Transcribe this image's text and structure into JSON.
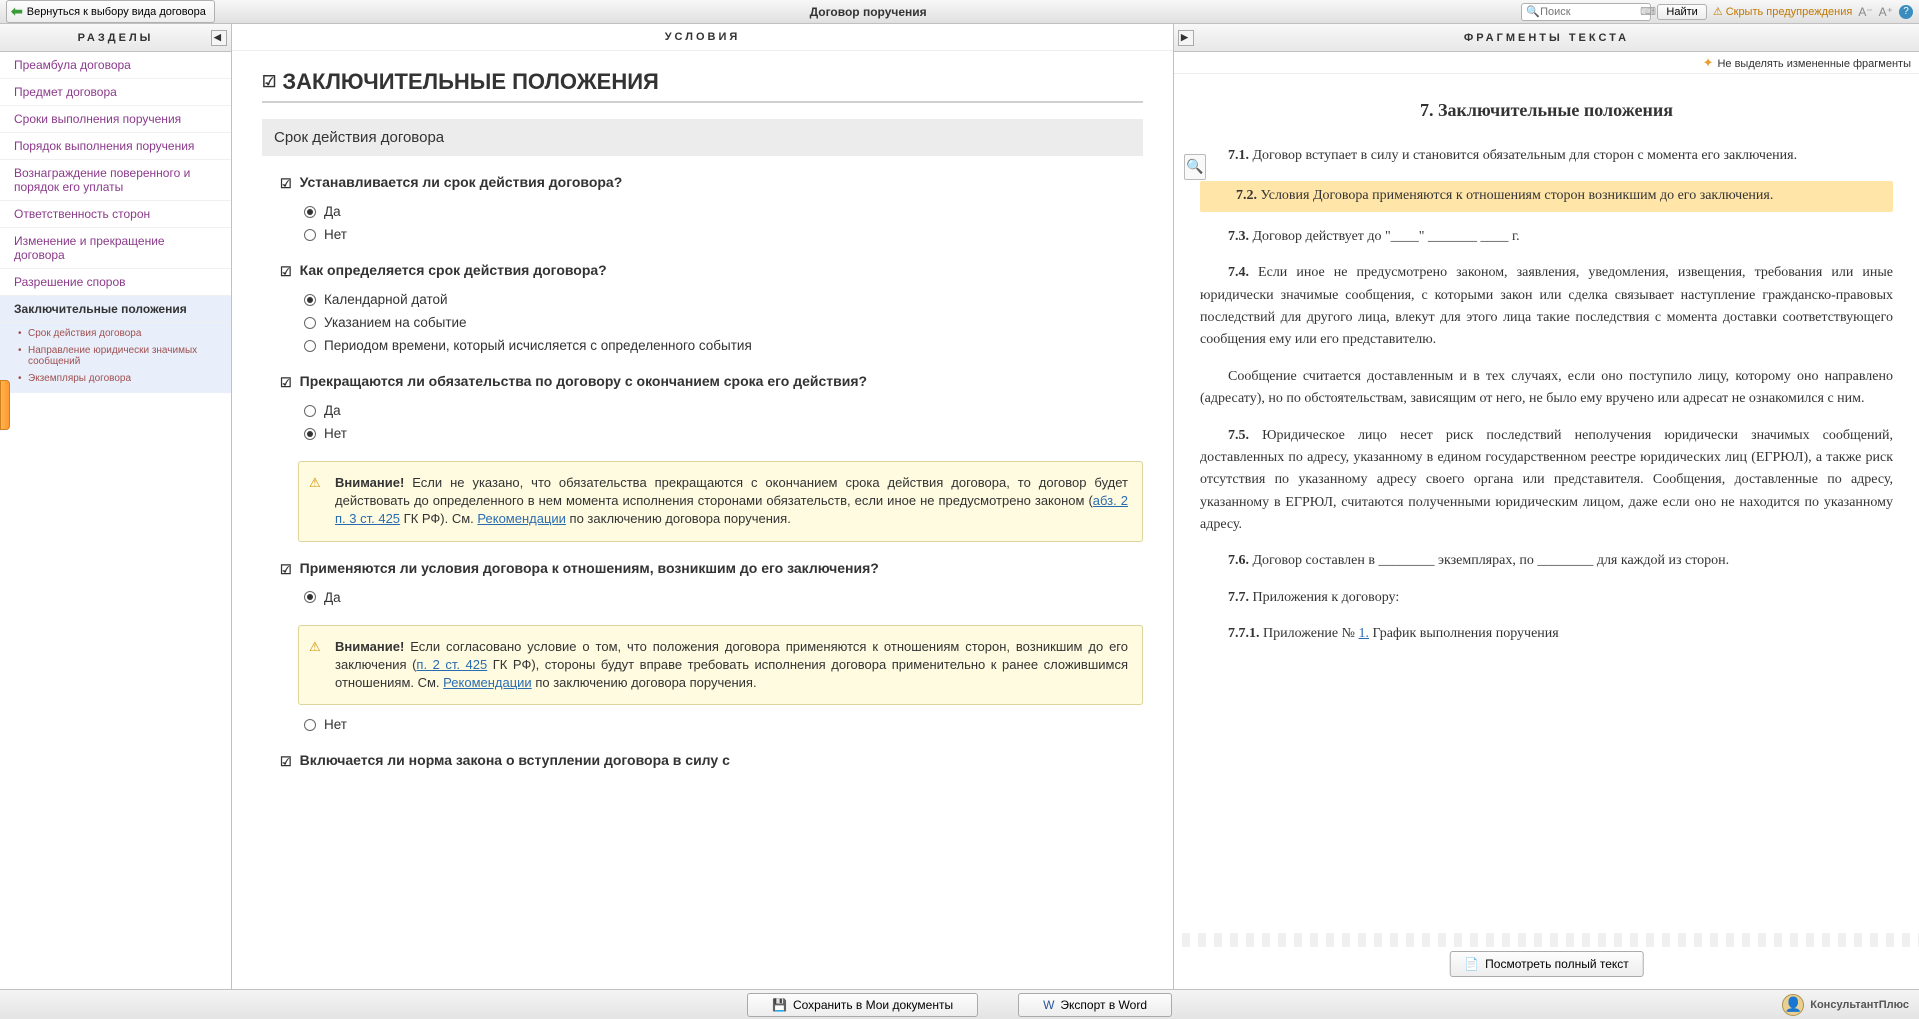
{
  "topbar": {
    "back_label": "Вернуться к выбору вида договора",
    "title": "Договор поручения",
    "search_placeholder": "Поиск",
    "find_label": "Найти",
    "hide_warnings": "Скрыть предупреждения"
  },
  "sidebar": {
    "header": "РАЗДЕЛЫ",
    "items": [
      "Преамбула договора",
      "Предмет договора",
      "Сроки выполнения поручения",
      "Порядок выполнения поручения",
      "Вознаграждение поверенного и порядок его уплаты",
      "Ответственность сторон",
      "Изменение и прекращение договора",
      "Разрешение споров"
    ],
    "active_section": "Заключительные положения",
    "sub_items": [
      "Срок действия договора",
      "Направление юридически значимых сообщений",
      "Экземпляры договора"
    ]
  },
  "center": {
    "header": "УСЛОВИЯ",
    "main_heading": "ЗАКЛЮЧИТЕЛЬНЫЕ ПОЛОЖЕНИЯ",
    "subsection": "Срок действия договора",
    "q1": {
      "text": "Устанавливается ли срок действия договора?",
      "opts": [
        "Да",
        "Нет"
      ],
      "selected": 0
    },
    "q2": {
      "text": "Как определяется срок действия договора?",
      "opts": [
        "Календарной датой",
        "Указанием на событие",
        "Периодом времени, который исчисляется с определенного события"
      ],
      "selected": 0
    },
    "q3": {
      "text": "Прекращаются ли обязательства по договору с окончанием срока его действия?",
      "opts": [
        "Да",
        "Нет"
      ],
      "selected": 1
    },
    "warning1": {
      "label": "Внимание!",
      "body_pre": " Если не указано, что обязательства прекращаются с окончанием срока действия договора, то договор будет действовать до определенного в нем момента исполнения сторонами обязательств, если иное не предусмотрено законом (",
      "link1": "абз. 2 п. 3 ст. 425",
      "mid": " ГК РФ). См. ",
      "link2": "Рекомендации",
      "body_post": " по заключению договора поручения."
    },
    "q4": {
      "text": "Применяются ли условия договора к отношениям, возникшим до его заключения?",
      "opts": [
        "Да",
        "Нет"
      ],
      "selected": 0
    },
    "warning2": {
      "label": "Внимание!",
      "body_pre": " Если согласовано условие о том, что положения договора применяются к отношениям сторон, возникшим до его заключения (",
      "link1": "п. 2 ст. 425",
      "mid": " ГК РФ), стороны будут вправе требовать исполнения договора применительно к ранее сложившимся отношениям. См. ",
      "link2": "Рекомендации",
      "body_post": " по заключению договора поручения."
    },
    "q5_partial": "Включается ли норма закона о вступлении договора в силу с"
  },
  "right": {
    "header": "ФРАГМЕНТЫ ТЕКСТА",
    "no_highlight": "Не выделять измененные фрагменты",
    "doc_title": "7. Заключительные положения",
    "p1_num": "7.1.",
    "p1": " Договор вступает в силу и становится обязательным для сторон с момента его заключения.",
    "p2_num": "7.2.",
    "p2": " Условия Договора применяются к отношениям сторон возникшим до его заключения.",
    "p3_num": "7.3.",
    "p3": " Договор действует до \"____\" _______ ____ г.",
    "p4_num": "7.4.",
    "p4": " Если иное не предусмотрено законом, заявления, уведомления, извещения, требования или иные юридически значимые сообщения, с которыми закон или сделка связывает наступление гражданско-правовых последствий для другого лица, влекут для этого лица такие последствия с момента доставки соответствующего сообщения ему или его представителю.",
    "p4b": "Сообщение считается доставленным и в тех случаях, если оно поступило лицу, которому оно направлено (адресату), но по обстоятельствам, зависящим от него, не было ему вручено или адресат не ознакомился с ним.",
    "p5_num": "7.5.",
    "p5": " Юридическое лицо несет риск последствий неполучения юридически значимых сообщений, доставленных по адресу, указанному в едином государственном реестре юридических лиц (ЕГРЮЛ), а также риск отсутствия по указанному адресу своего органа или представителя. Сообщения, доставленные по адресу, указанному в ЕГРЮЛ, считаются полученными юридическим лицом, даже если оно не находится по указанному адресу.",
    "p6_num": "7.6.",
    "p6": " Договор составлен в ________ экземплярах, по ________ для каждой из сторон.",
    "p7_num": "7.7.",
    "p7": " Приложения к договору:",
    "p771_num": "7.7.1.",
    "p771_pre": " Приложение № ",
    "p771_link": "1.",
    "p771_post": " График выполнения поручения",
    "view_full": "Посмотреть полный текст"
  },
  "bottom": {
    "save": "Сохранить в Мои документы",
    "export": "Экспорт в Word",
    "brand": "КонсультантПлюс"
  }
}
